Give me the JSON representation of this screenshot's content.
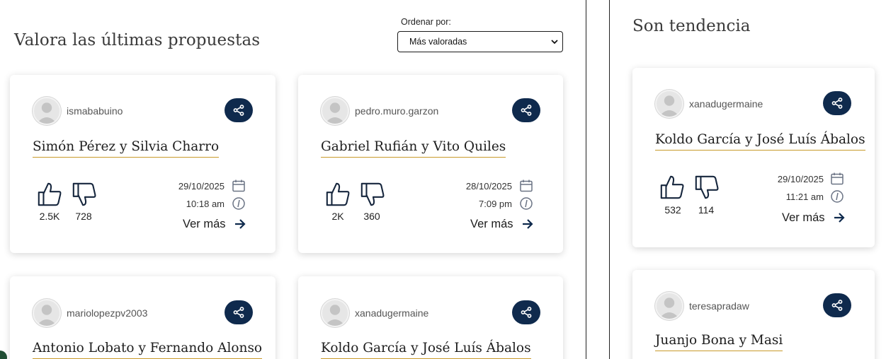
{
  "main": {
    "title": "Valora las últimas propuestas",
    "sort": {
      "label": "Ordenar por:",
      "selected": "Más valoradas"
    },
    "cards": [
      {
        "user": "ismababuino",
        "title": "Simón Pérez y Silvia Charro",
        "likes": "2.5K",
        "dislikes": "728",
        "date": "29/10/2025",
        "time": "10:18 am",
        "more": "Ver más"
      },
      {
        "user": "pedro.muro.garzon",
        "title": "Gabriel Rufián y Vito Quiles",
        "likes": "2K",
        "dislikes": "360",
        "date": "28/10/2025",
        "time": "7:09 pm",
        "more": "Ver más"
      },
      {
        "user": "mariolopezpv2003",
        "title": "Antonio Lobato y Fernando Alonso"
      },
      {
        "user": "xanadugermaine",
        "title": "Koldo García y José Luís Ábalos"
      }
    ]
  },
  "sidebar": {
    "title": "Son tendencia",
    "cards": [
      {
        "user": "xanadugermaine",
        "title": "Koldo García y José Luís Ábalos",
        "likes": "532",
        "dislikes": "114",
        "date": "29/10/2025",
        "time": "11:21 am",
        "more": "Ver más"
      },
      {
        "user": "teresapradaw",
        "title": "Juanjo Bona y Masi"
      }
    ]
  },
  "colors": {
    "accent_navy": "#0f2a4d",
    "title_underline": "#c89a2a"
  },
  "icons": [
    "share-icon",
    "thumbs-up-icon",
    "thumbs-down-icon",
    "calendar-icon",
    "clock-icon",
    "arrow-right-icon",
    "avatar-placeholder-icon",
    "chevron-down-icon"
  ]
}
